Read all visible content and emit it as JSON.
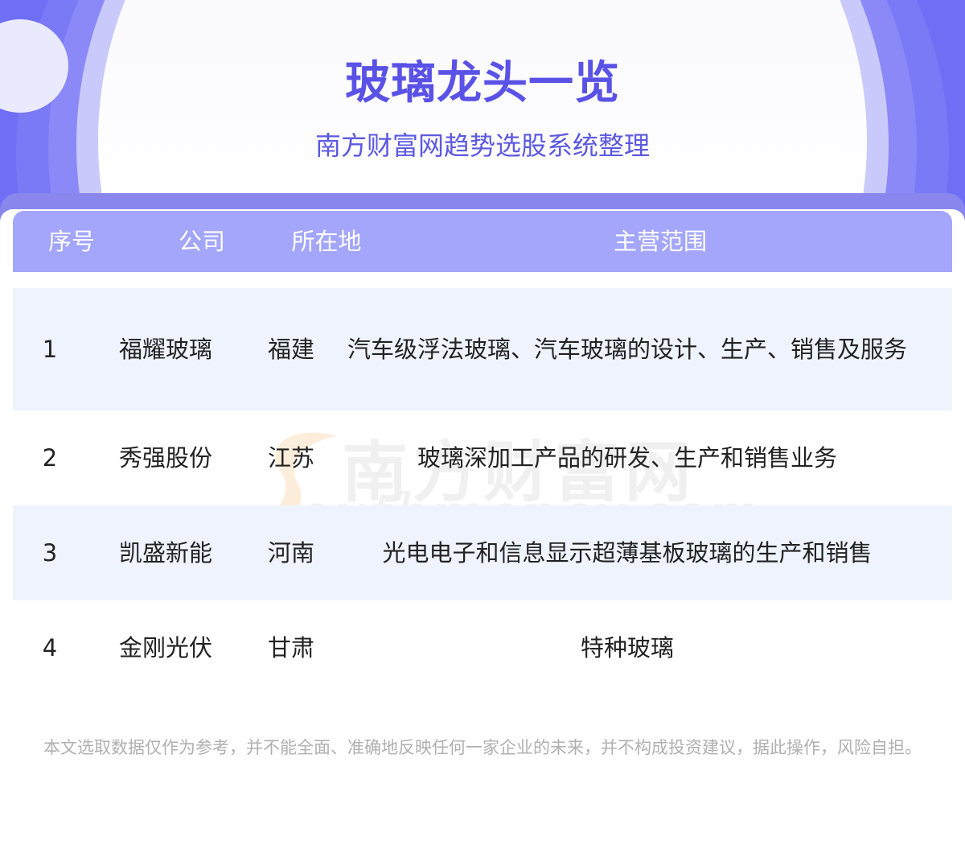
{
  "header": {
    "title": "玻璃龙头一览",
    "subtitle": "南方财富网趋势选股系统整理"
  },
  "table": {
    "columns": [
      "序号",
      "公司",
      "所在地",
      "主营范围"
    ],
    "rows": [
      {
        "no": "1",
        "company": "福耀玻璃",
        "location": "福建",
        "scope": "汽车级浮法玻璃、汽车玻璃的设计、生产、销售及服务"
      },
      {
        "no": "2",
        "company": "秀强股份",
        "location": "江苏",
        "scope": "玻璃深加工产品的研发、生产和销售业务"
      },
      {
        "no": "3",
        "company": "凯盛新能",
        "location": "河南",
        "scope": "光电电子和信息显示超薄基板玻璃的生产和销售"
      },
      {
        "no": "4",
        "company": "金刚光伏",
        "location": "甘肃",
        "scope": "特种玻璃"
      }
    ]
  },
  "watermark": {
    "cn": "南方财富网",
    "en": "outhmoney.com"
  },
  "disclaimer": "本文选取数据仅作为参考，并不能全面、准确地反映任何一家企业的未来，并不构成投资建议，据此操作，风险自担。",
  "colors": {
    "header_bg": "#6f6ef5",
    "title": "#5a52e6",
    "table_head": "#a3a6fb",
    "row_alt": "#eef3fd"
  }
}
